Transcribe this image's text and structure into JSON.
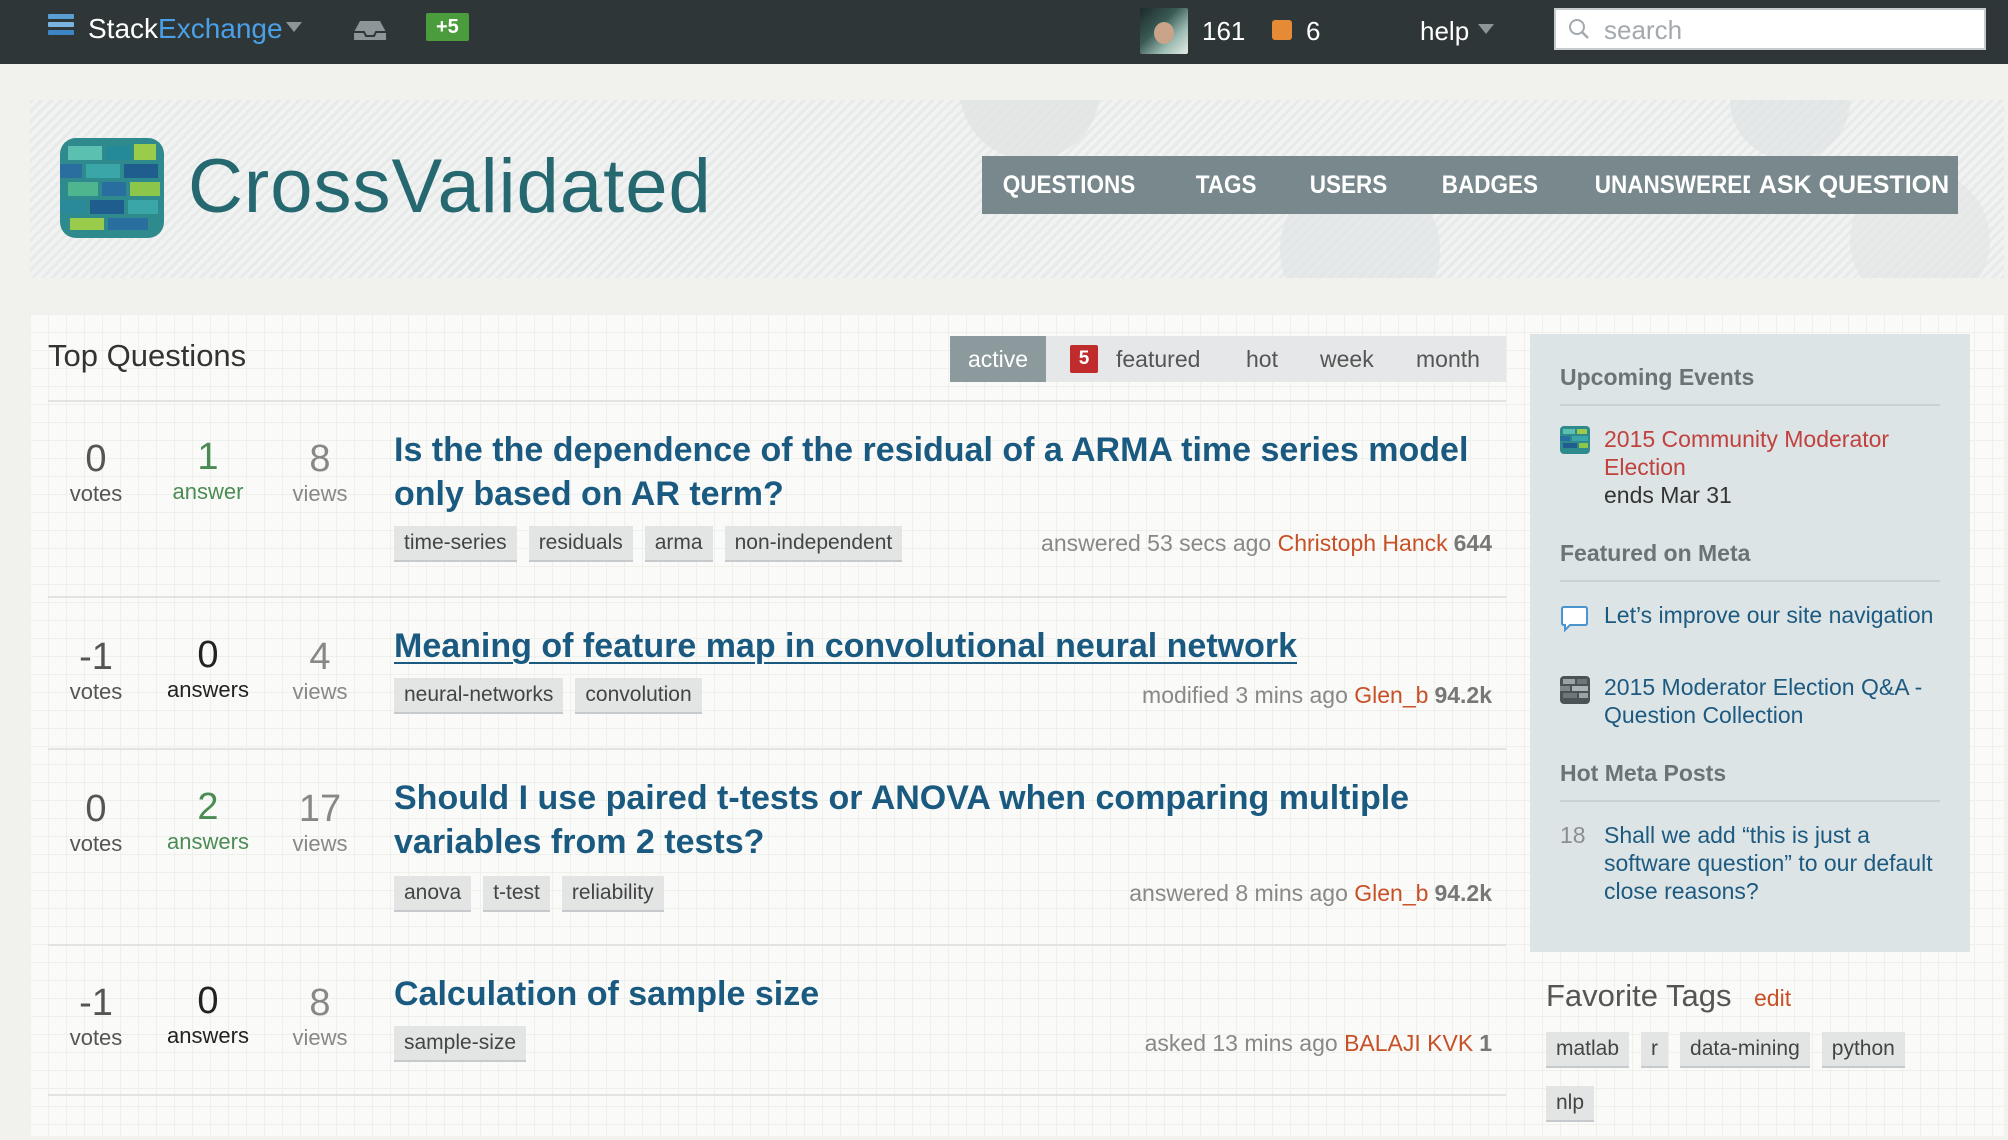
{
  "topbar": {
    "brand_part1": "Stack",
    "brand_part2": "Exchange",
    "rep_change": "+5",
    "reputation": "161",
    "achievements": "6",
    "help_label": "help",
    "search_placeholder": "search"
  },
  "header": {
    "site_title": "CrossValidated",
    "nav": [
      "QUESTIONS",
      "TAGS",
      "USERS",
      "BADGES",
      "UNANSWERED"
    ],
    "ask_button": "ASK QUESTION"
  },
  "main": {
    "page_title": "Top Questions",
    "tabs": {
      "active": "active",
      "featured_count": "5",
      "featured": "featured",
      "hot": "hot",
      "week": "week",
      "month": "month"
    },
    "questions": [
      {
        "votes": "0",
        "votes_label": "votes",
        "answers": "1",
        "answers_label": "answer",
        "views": "8",
        "views_label": "views",
        "title": "Is the the dependence of the residual of a ARMA time series model only based on AR term?",
        "tags": [
          "time-series",
          "residuals",
          "arma",
          "non-independent"
        ],
        "action": "answered 53 secs ago",
        "user": "Christoph Hanck",
        "rep": "644"
      },
      {
        "votes": "-1",
        "votes_label": "votes",
        "answers": "0",
        "answers_label": "answers",
        "views": "4",
        "views_label": "views",
        "title": "Meaning of feature map in convolutional neural network",
        "tags": [
          "neural-networks",
          "convolution"
        ],
        "action": "modified 3 mins ago",
        "user": "Glen_b",
        "rep": "94.2k"
      },
      {
        "votes": "0",
        "votes_label": "votes",
        "answers": "2",
        "answers_label": "answers",
        "views": "17",
        "views_label": "views",
        "title": "Should I use paired t-tests or ANOVA when comparing multiple variables from 2 tests?",
        "tags": [
          "anova",
          "t-test",
          "reliability"
        ],
        "action": "answered 8 mins ago",
        "user": "Glen_b",
        "rep": "94.2k"
      },
      {
        "votes": "-1",
        "votes_label": "votes",
        "answers": "0",
        "answers_label": "answers",
        "views": "8",
        "views_label": "views",
        "title": "Calculation of sample size",
        "tags": [
          "sample-size"
        ],
        "action": "asked 13 mins ago",
        "user": "BALAJI KVK",
        "rep": "1"
      }
    ]
  },
  "sidebar": {
    "upcoming_heading": "Upcoming Events",
    "event_title": "2015 Community Moderator Election",
    "event_sub": "ends Mar 31",
    "featured_heading": "Featured on Meta",
    "featured_items": [
      "Let’s improve our site navigation",
      "2015 Moderator Election Q&A - Question Collection"
    ],
    "hot_heading": "Hot Meta Posts",
    "hot_count": "18",
    "hot_item": "Shall we add “this is just a software question” to our default close reasons?",
    "favorite_tags_title": "Favorite Tags",
    "favorite_tags_edit": "edit",
    "favorite_tags": [
      "matlab",
      "r",
      "data-mining",
      "python",
      "nlp"
    ]
  },
  "colors": {
    "topbar": "#2f3638",
    "brand_blue": "#4aa0e8",
    "title_link": "#1a5a80",
    "user_link": "#c85026",
    "answered_green": "#4b8c55",
    "nav_gray": "#78888c"
  }
}
